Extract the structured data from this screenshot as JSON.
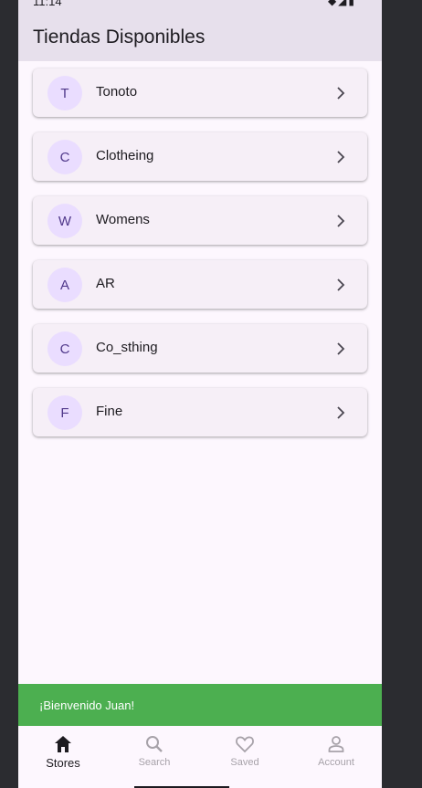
{
  "status": {
    "time": "11:14"
  },
  "appbar": {
    "title": "Tiendas Disponibles"
  },
  "stores": [
    {
      "initial": "T",
      "name": "Tonoto"
    },
    {
      "initial": "C",
      "name": "Clotheing"
    },
    {
      "initial": "W",
      "name": "Womens"
    },
    {
      "initial": "A",
      "name": "AR"
    },
    {
      "initial": "C",
      "name": "Co_sthing"
    },
    {
      "initial": "F",
      "name": "Fine"
    }
  ],
  "snackbar": {
    "message": "¡Bienvenido Juan!",
    "color": "#4caf50"
  },
  "bottom_nav": [
    {
      "label": "Stores",
      "icon": "home-icon",
      "active": true
    },
    {
      "label": "Search",
      "icon": "search-icon",
      "active": false
    },
    {
      "label": "Saved",
      "icon": "heart-icon",
      "active": false
    },
    {
      "label": "Account",
      "icon": "person-icon",
      "active": false
    }
  ],
  "colors": {
    "accent": "#eaddff",
    "avatar_text": "#4f378a",
    "background": "#fdf7fe"
  }
}
